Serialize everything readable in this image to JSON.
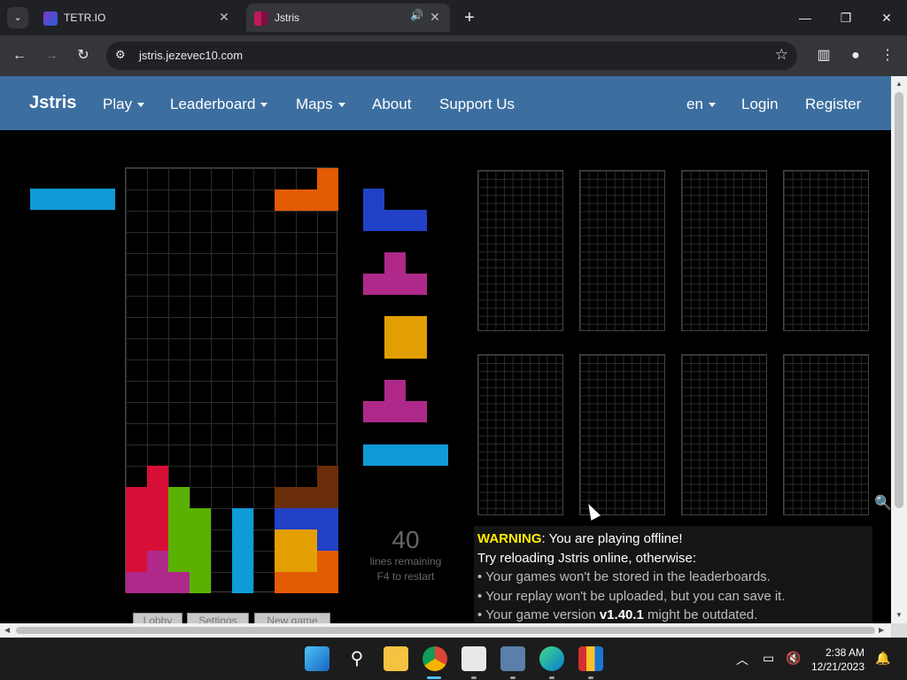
{
  "browser": {
    "tabs": [
      {
        "title": "TETR.IO",
        "close": "✕"
      },
      {
        "title": "Jstris",
        "close": "✕"
      }
    ],
    "new_tab": "+",
    "url": "jstris.jezevec10.com"
  },
  "nav": {
    "brand": "Jstris",
    "items": [
      {
        "label": "Play",
        "dropdown": true
      },
      {
        "label": "Leaderboard",
        "dropdown": true
      },
      {
        "label": "Maps",
        "dropdown": true
      },
      {
        "label": "About",
        "dropdown": false
      },
      {
        "label": "Support Us",
        "dropdown": false
      }
    ],
    "lang": "en",
    "login": "Login",
    "register": "Register"
  },
  "game": {
    "lines_remaining": "40",
    "lines_label": "lines remaining",
    "restart_hint": "F4 to restart",
    "buttons": [
      "Lobby",
      "Settings",
      "New game"
    ],
    "hold_piece": "I",
    "queue": [
      "J",
      "T",
      "O",
      "T",
      "I"
    ],
    "colors": {
      "I": "#0f9bd7",
      "J": "#2141c6",
      "T": "#af298a",
      "O": "#e39f02",
      "L": "#e35b02",
      "S": "#59b101",
      "Z": "#d70f37",
      "garbage_dark": "#6b2e0a"
    }
  },
  "warning": {
    "title": "WARNING",
    "title_rest": ": You are playing offline!",
    "line2": "Try reloading Jstris online, otherwise:",
    "bullets": [
      "• Your games won't be stored in the leaderboards.",
      "• Your replay won't be uploaded, but you can save it."
    ],
    "bullet3_pre": "• Your game version ",
    "version": "v1.40.1",
    "bullet3_post": " might be outdated."
  },
  "taskbar": {
    "time": "2:38 AM",
    "date": "12/21/2023"
  }
}
